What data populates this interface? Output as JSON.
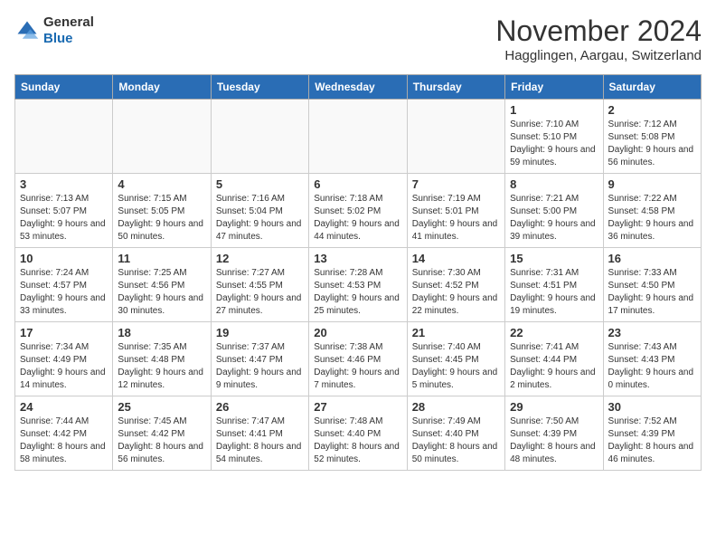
{
  "header": {
    "logo_line1": "General",
    "logo_line2": "Blue",
    "month_title": "November 2024",
    "location": "Hagglingen, Aargau, Switzerland"
  },
  "days_of_week": [
    "Sunday",
    "Monday",
    "Tuesday",
    "Wednesday",
    "Thursday",
    "Friday",
    "Saturday"
  ],
  "weeks": [
    [
      {
        "day": "",
        "info": ""
      },
      {
        "day": "",
        "info": ""
      },
      {
        "day": "",
        "info": ""
      },
      {
        "day": "",
        "info": ""
      },
      {
        "day": "",
        "info": ""
      },
      {
        "day": "1",
        "info": "Sunrise: 7:10 AM\nSunset: 5:10 PM\nDaylight: 9 hours and 59 minutes."
      },
      {
        "day": "2",
        "info": "Sunrise: 7:12 AM\nSunset: 5:08 PM\nDaylight: 9 hours and 56 minutes."
      }
    ],
    [
      {
        "day": "3",
        "info": "Sunrise: 7:13 AM\nSunset: 5:07 PM\nDaylight: 9 hours and 53 minutes."
      },
      {
        "day": "4",
        "info": "Sunrise: 7:15 AM\nSunset: 5:05 PM\nDaylight: 9 hours and 50 minutes."
      },
      {
        "day": "5",
        "info": "Sunrise: 7:16 AM\nSunset: 5:04 PM\nDaylight: 9 hours and 47 minutes."
      },
      {
        "day": "6",
        "info": "Sunrise: 7:18 AM\nSunset: 5:02 PM\nDaylight: 9 hours and 44 minutes."
      },
      {
        "day": "7",
        "info": "Sunrise: 7:19 AM\nSunset: 5:01 PM\nDaylight: 9 hours and 41 minutes."
      },
      {
        "day": "8",
        "info": "Sunrise: 7:21 AM\nSunset: 5:00 PM\nDaylight: 9 hours and 39 minutes."
      },
      {
        "day": "9",
        "info": "Sunrise: 7:22 AM\nSunset: 4:58 PM\nDaylight: 9 hours and 36 minutes."
      }
    ],
    [
      {
        "day": "10",
        "info": "Sunrise: 7:24 AM\nSunset: 4:57 PM\nDaylight: 9 hours and 33 minutes."
      },
      {
        "day": "11",
        "info": "Sunrise: 7:25 AM\nSunset: 4:56 PM\nDaylight: 9 hours and 30 minutes."
      },
      {
        "day": "12",
        "info": "Sunrise: 7:27 AM\nSunset: 4:55 PM\nDaylight: 9 hours and 27 minutes."
      },
      {
        "day": "13",
        "info": "Sunrise: 7:28 AM\nSunset: 4:53 PM\nDaylight: 9 hours and 25 minutes."
      },
      {
        "day": "14",
        "info": "Sunrise: 7:30 AM\nSunset: 4:52 PM\nDaylight: 9 hours and 22 minutes."
      },
      {
        "day": "15",
        "info": "Sunrise: 7:31 AM\nSunset: 4:51 PM\nDaylight: 9 hours and 19 minutes."
      },
      {
        "day": "16",
        "info": "Sunrise: 7:33 AM\nSunset: 4:50 PM\nDaylight: 9 hours and 17 minutes."
      }
    ],
    [
      {
        "day": "17",
        "info": "Sunrise: 7:34 AM\nSunset: 4:49 PM\nDaylight: 9 hours and 14 minutes."
      },
      {
        "day": "18",
        "info": "Sunrise: 7:35 AM\nSunset: 4:48 PM\nDaylight: 9 hours and 12 minutes."
      },
      {
        "day": "19",
        "info": "Sunrise: 7:37 AM\nSunset: 4:47 PM\nDaylight: 9 hours and 9 minutes."
      },
      {
        "day": "20",
        "info": "Sunrise: 7:38 AM\nSunset: 4:46 PM\nDaylight: 9 hours and 7 minutes."
      },
      {
        "day": "21",
        "info": "Sunrise: 7:40 AM\nSunset: 4:45 PM\nDaylight: 9 hours and 5 minutes."
      },
      {
        "day": "22",
        "info": "Sunrise: 7:41 AM\nSunset: 4:44 PM\nDaylight: 9 hours and 2 minutes."
      },
      {
        "day": "23",
        "info": "Sunrise: 7:43 AM\nSunset: 4:43 PM\nDaylight: 9 hours and 0 minutes."
      }
    ],
    [
      {
        "day": "24",
        "info": "Sunrise: 7:44 AM\nSunset: 4:42 PM\nDaylight: 8 hours and 58 minutes."
      },
      {
        "day": "25",
        "info": "Sunrise: 7:45 AM\nSunset: 4:42 PM\nDaylight: 8 hours and 56 minutes."
      },
      {
        "day": "26",
        "info": "Sunrise: 7:47 AM\nSunset: 4:41 PM\nDaylight: 8 hours and 54 minutes."
      },
      {
        "day": "27",
        "info": "Sunrise: 7:48 AM\nSunset: 4:40 PM\nDaylight: 8 hours and 52 minutes."
      },
      {
        "day": "28",
        "info": "Sunrise: 7:49 AM\nSunset: 4:40 PM\nDaylight: 8 hours and 50 minutes."
      },
      {
        "day": "29",
        "info": "Sunrise: 7:50 AM\nSunset: 4:39 PM\nDaylight: 8 hours and 48 minutes."
      },
      {
        "day": "30",
        "info": "Sunrise: 7:52 AM\nSunset: 4:39 PM\nDaylight: 8 hours and 46 minutes."
      }
    ]
  ]
}
